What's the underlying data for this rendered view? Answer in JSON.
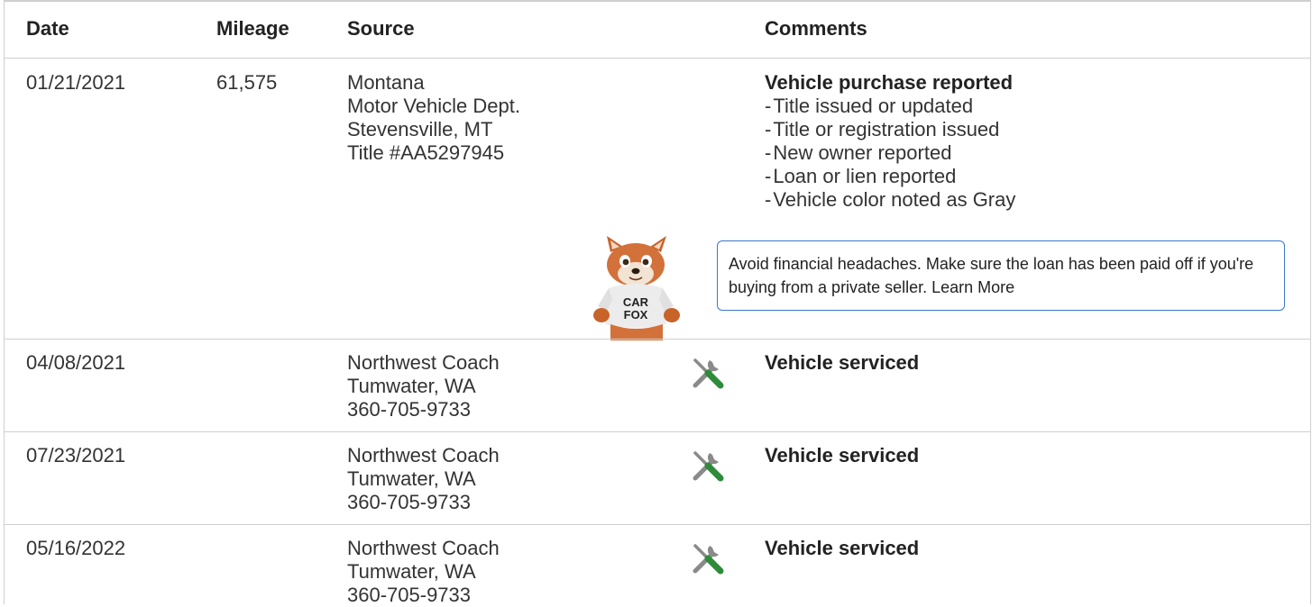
{
  "header": {
    "date": "Date",
    "mileage": "Mileage",
    "source": "Source",
    "comments": "Comments"
  },
  "rows": [
    {
      "date": "01/21/2021",
      "mileage": "61,575",
      "source": [
        "Montana",
        "Motor Vehicle Dept.",
        "Stevensville, MT",
        "Title #AA5297945"
      ],
      "comment_title": "Vehicle purchase reported",
      "comment_items": [
        "Title issued or updated",
        "Title or registration issued",
        "New owner reported",
        "Loan or lien reported",
        "Vehicle color noted as Gray"
      ],
      "tip_text": "Avoid financial headaches. Make sure the loan has been paid off if you're buying from a private seller.",
      "tip_link": "Learn More",
      "mascot_text": "CAR FOX"
    },
    {
      "date": "04/08/2021",
      "mileage": "",
      "source": [
        "Northwest Coach",
        "Tumwater, WA",
        "360-705-9733"
      ],
      "comment_title": "Vehicle serviced"
    },
    {
      "date": "07/23/2021",
      "mileage": "",
      "source": [
        "Northwest Coach",
        "Tumwater, WA",
        "360-705-9733"
      ],
      "comment_title": "Vehicle serviced"
    },
    {
      "date": "05/16/2022",
      "mileage": "",
      "source": [
        "Northwest Coach",
        "Tumwater, WA",
        "360-705-9733"
      ],
      "comment_title": "Vehicle serviced"
    }
  ],
  "icons": {
    "service": "wrench-screwdriver-icon",
    "mascot": "car-fox-mascot"
  },
  "colors": {
    "border": "#cfcfcf",
    "tip_border": "#3a78c9",
    "wrench_gray": "#8a8a8a",
    "screwdriver_green": "#2e8b3a"
  }
}
